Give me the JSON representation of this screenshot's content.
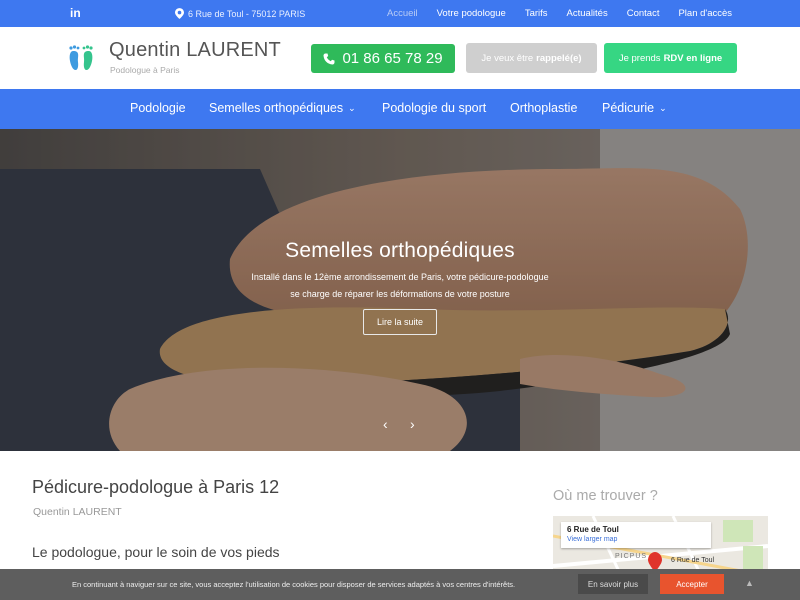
{
  "topbar": {
    "linkedin": "in",
    "address": "6 Rue de Toul - 75012 PARIS",
    "links": [
      "Accueil",
      "Votre podologue",
      "Tarifs",
      "Actualités",
      "Contact",
      "Plan d'accès"
    ]
  },
  "header": {
    "brand": "Quentin LAURENT",
    "subtitle": "Podologue à Paris",
    "phone": "01 86 65 78 29",
    "callback_prefix": "Je veux être",
    "callback_bold": "rappelé(e)",
    "rdv_prefix": "Je prends",
    "rdv_bold": "RDV en ligne"
  },
  "nav": {
    "items": [
      "Podologie",
      "Semelles orthopédiques",
      "Podologie du sport",
      "Orthoplastie",
      "Pédicurie"
    ]
  },
  "hero": {
    "title": "Semelles orthopédiques",
    "text": "Installé dans le 12ème arrondissement de Paris, votre pédicure-podologue se charge de réparer les déformations de votre posture",
    "button": "Lire la suite",
    "prev": "‹",
    "next": "›"
  },
  "main": {
    "title": "Pédicure-podologue à Paris 12",
    "author": "Quentin LAURENT",
    "heading": "Le podologue, pour le soin de vos pieds"
  },
  "aside": {
    "title": "Où me trouver ?",
    "map_card_title": "6 Rue de Toul",
    "map_card_link": "View larger map",
    "map_pin_label": "6 Rue de Toul",
    "map_district": "PICPUS"
  },
  "cookie": {
    "text": "En continuant à naviguer sur ce site, vous acceptez l'utilisation de cookies pour disposer de services adaptés à vos centres d'intérêts.",
    "more": "En savoir plus",
    "accept": "Accepter",
    "up": "▲"
  },
  "colors": {
    "primary": "#3e78f0",
    "phone_btn": "#2fba5a",
    "rdv_btn": "#36d683",
    "callback_btn": "#cfcfcf",
    "accept_btn": "#e8542e"
  }
}
